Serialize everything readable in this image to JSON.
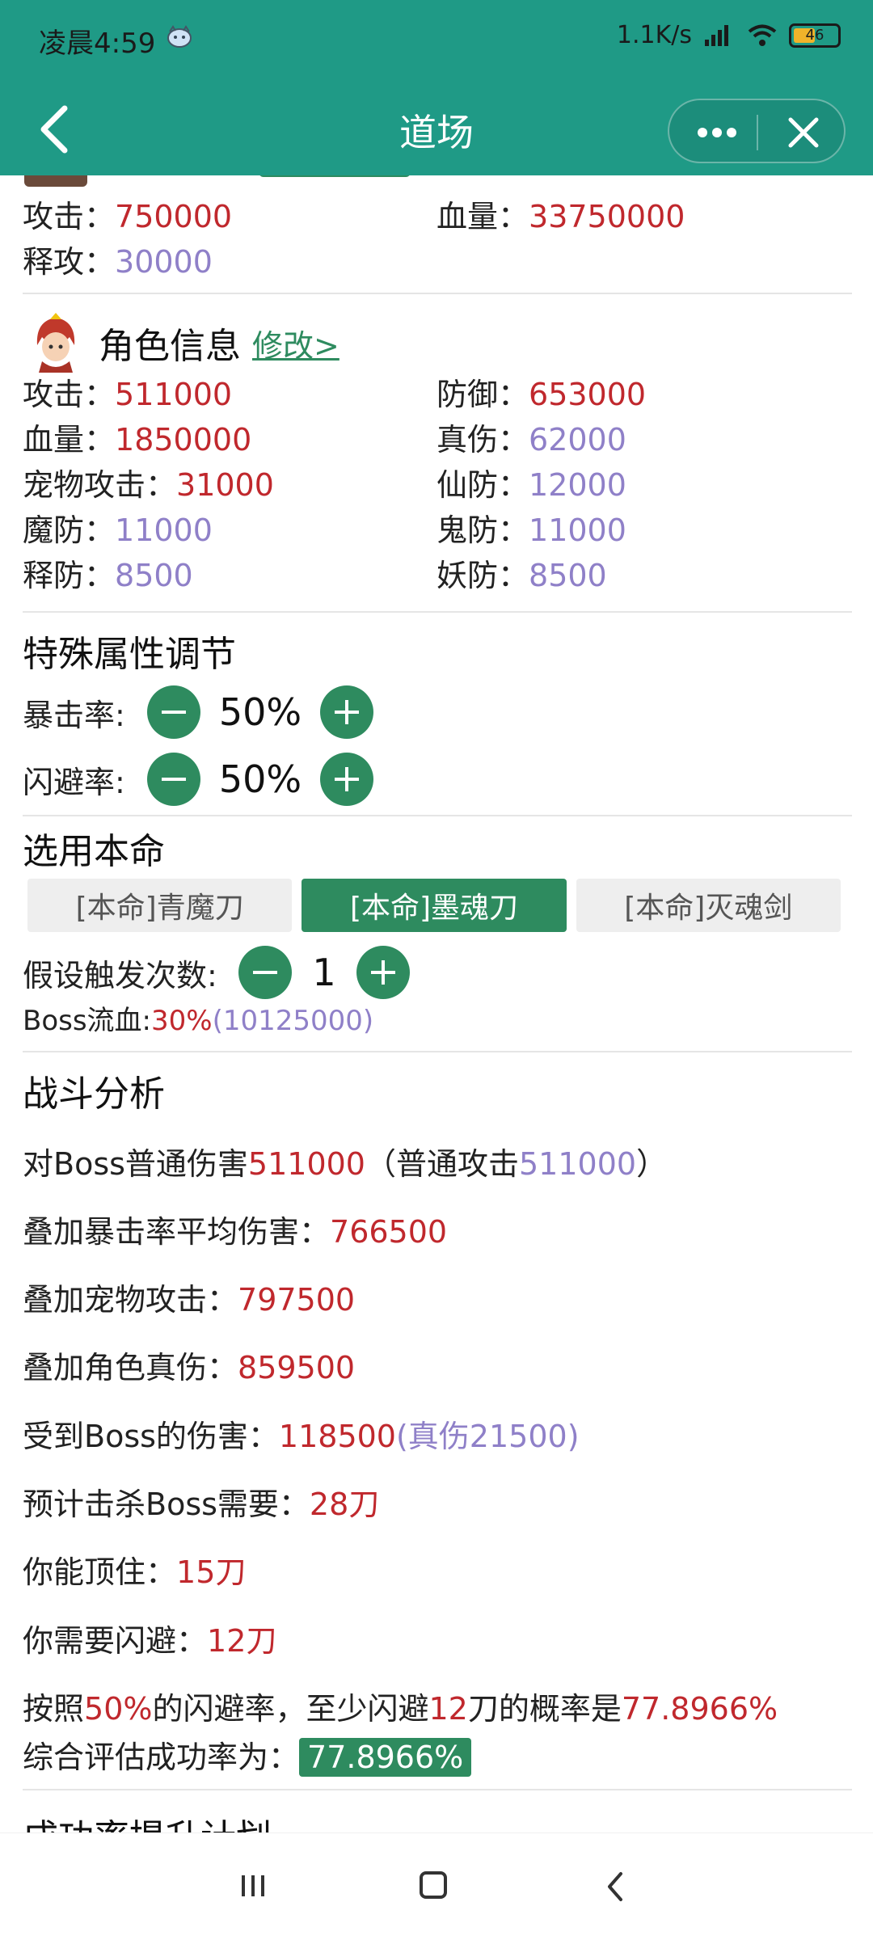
{
  "status_bar": {
    "time": "凌晨4:59",
    "net_speed": "1.1K/s",
    "battery": "46"
  },
  "nav": {
    "title": "道场"
  },
  "boss": {
    "attack_label": "攻击：",
    "attack_value": "750000",
    "hp_label": "血量：",
    "hp_value": "33750000",
    "release_attack_label": "释攻：",
    "release_attack_value": "30000"
  },
  "role": {
    "title": "角色信息",
    "modify_link": "修改>",
    "stats": [
      {
        "label": "攻击：",
        "value": "511000",
        "color": "#c0282d"
      },
      {
        "label": "防御：",
        "value": "653000",
        "color": "#c0282d"
      },
      {
        "label": "血量：",
        "value": "1850000",
        "color": "#c0282d"
      },
      {
        "label": "真伤：",
        "value": "62000",
        "color": "#8f80c8"
      },
      {
        "label": "宠物攻击：",
        "value": "31000",
        "color": "#c0282d"
      },
      {
        "label": "仙防：",
        "value": "12000",
        "color": "#8f80c8"
      },
      {
        "label": "魔防：",
        "value": "11000",
        "color": "#8f80c8"
      },
      {
        "label": "鬼防：",
        "value": "11000",
        "color": "#8f80c8"
      },
      {
        "label": "释防：",
        "value": "8500",
        "color": "#8f80c8"
      },
      {
        "label": "妖防：",
        "value": "8500",
        "color": "#8f80c8"
      }
    ]
  },
  "special": {
    "title": "特殊属性调节",
    "crit_label": "暴击率:",
    "crit_value": "50%",
    "dodge_label": "闪避率:",
    "dodge_value": "50%"
  },
  "destiny": {
    "title": "选用本命",
    "tabs": [
      "[本命]青魔刀",
      "[本命]墨魂刀",
      "[本命]灭魂剑"
    ],
    "active_tab": 1,
    "trigger_label": "假设触发次数:",
    "trigger_value": "1",
    "bleed_label": "Boss流血:",
    "bleed_percent": "30%",
    "bleed_amount": "(10125000)"
  },
  "analysis": {
    "title": "战斗分析",
    "normal_prefix": "对Boss普通伤害",
    "normal_value": "511000",
    "normal_paren_open": "（普通攻击",
    "normal_paren_value": "511000",
    "normal_paren_close": "）",
    "crit_avg_label": "叠加暴击率平均伤害：",
    "crit_avg_value": "766500",
    "pet_label": "叠加宠物攻击：",
    "pet_value": "797500",
    "true_dmg_label": "叠加角色真伤：",
    "true_dmg_value": "859500",
    "taken_label": "受到Boss的伤害：",
    "taken_value": "118500",
    "taken_true": "(真伤21500)",
    "kill_label": "预计击杀Boss需要：",
    "kill_value": "28刀",
    "withstand_label": "你能顶住：",
    "withstand_value": "15刀",
    "need_dodge_label": "你需要闪避：",
    "need_dodge_value": "12刀",
    "prob_text_1": "按照",
    "prob_rate": "50%",
    "prob_text_2": "的闪避率，至少闪避",
    "prob_count": "12",
    "prob_text_3": "刀的概率是",
    "prob_value": "77.8966%",
    "overall_label": "综合评估成功率为：",
    "overall_value": "77.8966%"
  },
  "next_section_title": "成功率提升计划"
}
